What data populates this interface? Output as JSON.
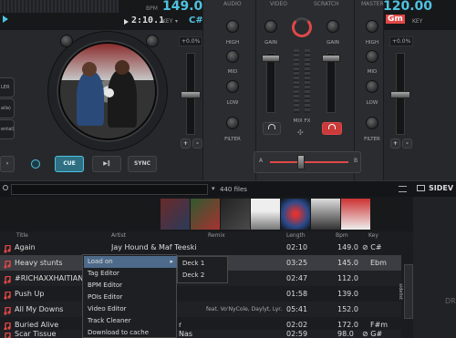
{
  "deck1": {
    "bpm_label": "BPM",
    "bpm_value": "149.00",
    "time": "2:10.1",
    "key_label": "KEY",
    "key_value": "C#",
    "side_buttons": [
      "LER",
      "alla)",
      "ental)"
    ],
    "pitch_value": "+0.0%",
    "cue_label": "CUE",
    "play_label": "▶‖",
    "sync_label": "SYNC",
    "prev_label": "›",
    "plus_label": "+",
    "minus_label": "-"
  },
  "deck2": {
    "bpm_value": "120.00",
    "key_value": "Gm",
    "key_label": "KEY",
    "pitch_value": "+0.0%"
  },
  "mixer": {
    "tabs": [
      "AUDIO",
      "VIDEO",
      "SCRATCH",
      "MASTER"
    ],
    "left_labels": [
      "HIGH",
      "MID",
      "LOW",
      "FILTER"
    ],
    "right_labels": [
      "HIGH",
      "MID",
      "LOW",
      "FILTER"
    ],
    "gain_left": "GAIN",
    "gain_right": "GAIN",
    "pitch_left": "+0.0%",
    "pitch_right": "+0.0%",
    "mix_fx": "MIX FX",
    "cross_a": "A",
    "cross_b": "B"
  },
  "browser": {
    "files_count": "440 files",
    "columns": [
      "Title",
      "Artist",
      "Remix",
      "Length",
      "Bpm",
      "Key"
    ],
    "tracks": [
      {
        "title": "Again",
        "artist": "Jay Hound & Maf Teeski",
        "remix": "",
        "length": "02:10",
        "bpm": "149.0",
        "key": "⊘ C#"
      },
      {
        "title": "Heavy stunts",
        "artist": "",
        "remix": "",
        "length": "03:25",
        "bpm": "145.0",
        "key": "Ebm"
      },
      {
        "title": "#RICHAXXHAITIAN",
        "artist": "",
        "remix": "",
        "length": "02:47",
        "bpm": "112.0",
        "key": ""
      },
      {
        "title": "Push Up",
        "artist": "",
        "remix": "",
        "length": "01:58",
        "bpm": "139.0",
        "key": ""
      },
      {
        "title": "All My Downs",
        "artist": "",
        "remix": "feat. Vo'NyCole, Daylyt, Lyr...",
        "length": "05:41",
        "bpm": "152.0",
        "key": ""
      },
      {
        "title": "Buried Alive",
        "artist": "r",
        "remix": "",
        "length": "02:02",
        "bpm": "172.0",
        "key": "F#m"
      },
      {
        "title": "Scar Tissue",
        "artist": "Nas",
        "remix": "",
        "length": "02:59",
        "bpm": "98.0",
        "key": "⊘ G#"
      }
    ],
    "right_panel_label": "SIDEV",
    "right_panel_sub": "DR",
    "sidebar_tab": "sidelist"
  },
  "context_menu": {
    "items": [
      "Load on",
      "Tag Editor",
      "BPM Editor",
      "POIs Editor",
      "Video Editor",
      "Track Cleaner",
      "Download to cache"
    ],
    "submenu": [
      "Deck 1",
      "Deck 2"
    ]
  },
  "colors": {
    "accent": "#4ec3e0",
    "red": "#e04848",
    "menu_highlight": "#4d6a8a"
  }
}
